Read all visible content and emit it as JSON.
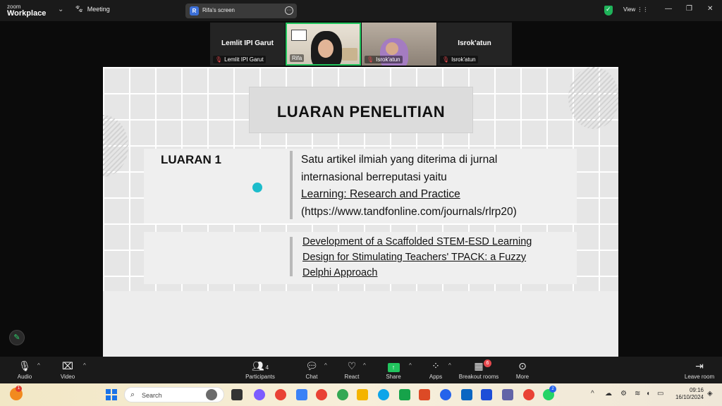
{
  "app": {
    "logo_line1": "zoom",
    "logo_line2": "Workplace",
    "meeting_label": "Meeting",
    "screen_share_label": "Rifa's screen",
    "screen_share_avatar": "R",
    "view_label": "View"
  },
  "participants": [
    {
      "display_name": "Lemlit IPI Garut",
      "label": "Lemlit IPI Garut",
      "muted": true,
      "video": false
    },
    {
      "label": "Rifa",
      "muted": false,
      "video": true,
      "active_speaker": true
    },
    {
      "label": "Isrok'atun",
      "muted": true,
      "video": true
    },
    {
      "display_name": "Isrok'atun",
      "label": "Isrok'atun",
      "muted": true,
      "video": false
    }
  ],
  "slide": {
    "title": "LUARAN PENELITIAN",
    "row1_label": "LUARAN 1",
    "row1_line1": "Satu artikel ilmiah yang diterima di jurnal",
    "row1_line2": "internasional berreputasi yaitu",
    "row1_journal": "Learning: Research and Practice",
    "row1_url": "(https://www.tandfonline.com/journals/rlrp20)",
    "row2_paper_line1": "Development of a Scaffolded STEM-ESD Learning",
    "row2_paper_line2": "Design for Stimulating Teachers' TPACK: a Fuzzy",
    "row2_paper_line3": "Delphi Approach"
  },
  "toolbar": {
    "audio": "Audio",
    "video": "Video",
    "participants": "Participants",
    "participants_count": "4",
    "chat": "Chat",
    "react": "React",
    "share": "Share",
    "apps": "Apps",
    "breakout": "Breakout rooms",
    "breakout_badge": "6",
    "more": "More",
    "leave": "Leave room"
  },
  "taskbar": {
    "search_placeholder": "Search",
    "weather_badge": "1",
    "whatsapp_badge": "2",
    "time": "09:16",
    "date": "16/10/2024"
  },
  "colors": {
    "active_speaker": "#22c55e",
    "muted": "#e5484d",
    "share": "#22c55e",
    "pointer": "#1cbccb"
  }
}
